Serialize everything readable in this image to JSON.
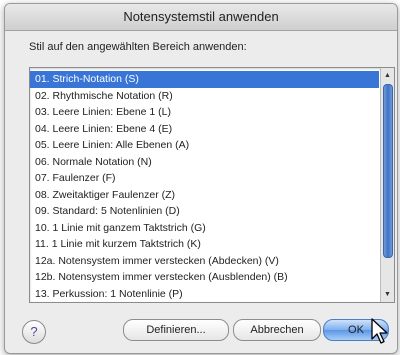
{
  "dialog": {
    "title": "Notensystemstil anwenden",
    "instruction": "Stil auf den angewählten Bereich anwenden:"
  },
  "list": {
    "selected_index": 0,
    "items": [
      "01. Strich-Notation (S)",
      "02. Rhythmische Notation (R)",
      "03. Leere Linien: Ebene 1 (L)",
      "04. Leere Linien: Ebene 4 (E)",
      "05. Leere Linien: Alle Ebenen (A)",
      "06. Normale Notation (N)",
      "07. Faulenzer (F)",
      "08. Zweitaktiger Faulenzer (Z)",
      "09. Standard: 5 Notenlinien (D)",
      "10. 1 Linie mit ganzem Taktstrich (G)",
      "11. 1 Linie mit kurzem Taktstrich (K)",
      "12a. Notensystem immer verstecken (Abdecken) (V)",
      "12b. Notensystem immer verstecken (Ausblenden) (B)",
      "13. Perkussion: 1 Notenlinie (P)"
    ]
  },
  "buttons": {
    "help": "?",
    "define": "Definieren...",
    "cancel": "Abbrechen",
    "ok": "OK"
  },
  "colors": {
    "selection": "#3875d7",
    "default_button": "#5b96e6"
  }
}
